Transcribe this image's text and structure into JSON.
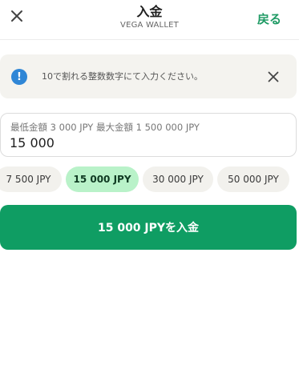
{
  "header": {
    "title": "入金",
    "subtitle": "VEGA WALLET",
    "back_label": "戻る",
    "close_icon": "close-icon"
  },
  "info": {
    "icon": "info-icon",
    "icon_glyph": "!",
    "text": "10で割れる整数数字にて入力ください。",
    "close_icon": "close-icon"
  },
  "amount": {
    "limits_text": "最低金額 3 000 JPY 最大金額 1 500 000 JPY",
    "value": "15 000"
  },
  "presets": [
    {
      "label": "7 500 JPY",
      "selected": false
    },
    {
      "label": "15 000 JPY",
      "selected": true
    },
    {
      "label": "30 000 JPY",
      "selected": false
    },
    {
      "label": "50 000 JPY",
      "selected": false
    }
  ],
  "deposit_button": {
    "label": "15 000 JPYを入金"
  },
  "colors": {
    "accent": "#0f9d63",
    "selected_chip": "#b9f2c9",
    "info_icon": "#2f86d6",
    "back_link": "#1e9a64"
  }
}
